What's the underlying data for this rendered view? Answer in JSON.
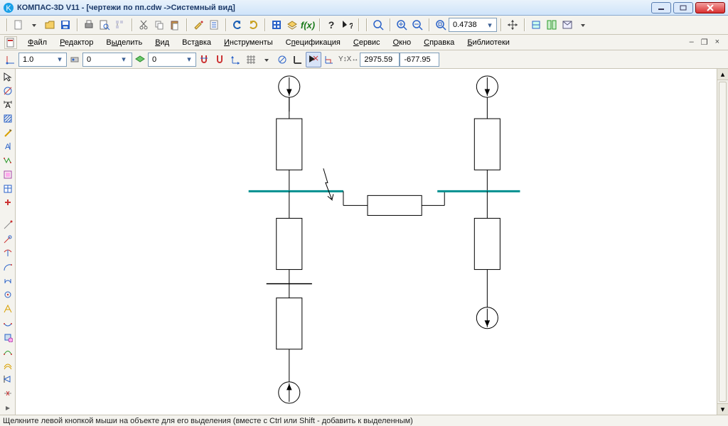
{
  "window": {
    "title": "КОМПАС-3D V11 - [чертежи по пп.cdw ->Системный вид]"
  },
  "toolbar1": {
    "zoom_value": "0.4738"
  },
  "menubar": {
    "items": [
      "Файл",
      "Редактор",
      "Выделить",
      "Вид",
      "Вставка",
      "Инструменты",
      "Спецификация",
      "Сервис",
      "Окно",
      "Справка",
      "Библиотеки"
    ],
    "mdi": {
      "minimize": "–",
      "restore": "❐",
      "close": "×"
    }
  },
  "propbar": {
    "scale": "1.0",
    "state": "0",
    "layer": "0",
    "coord_x": "2975.59",
    "coord_y": "-677.95"
  },
  "status": {
    "text": "Щелкните левой кнопкой мыши на объекте для его выделения (вместе с Ctrl или Shift - добавить к выделенным)"
  },
  "palette_names": [
    "cursor-icon",
    "geometry-icon",
    "dimension-icon",
    "hatch-icon",
    "text-icon",
    "axis-icon",
    "multiline-icon",
    "frame-icon",
    "table-icon",
    "plus-icon",
    "snap-icon",
    "circle-icon",
    "arc-icon",
    "curve-icon",
    "spline-icon",
    "polygon-icon",
    "point-icon",
    "ellipse-icon",
    "region-icon",
    "trim-icon",
    "offset-icon",
    "mirror-icon",
    "macro-icon",
    "symbol-icon",
    "expand-icon"
  ]
}
